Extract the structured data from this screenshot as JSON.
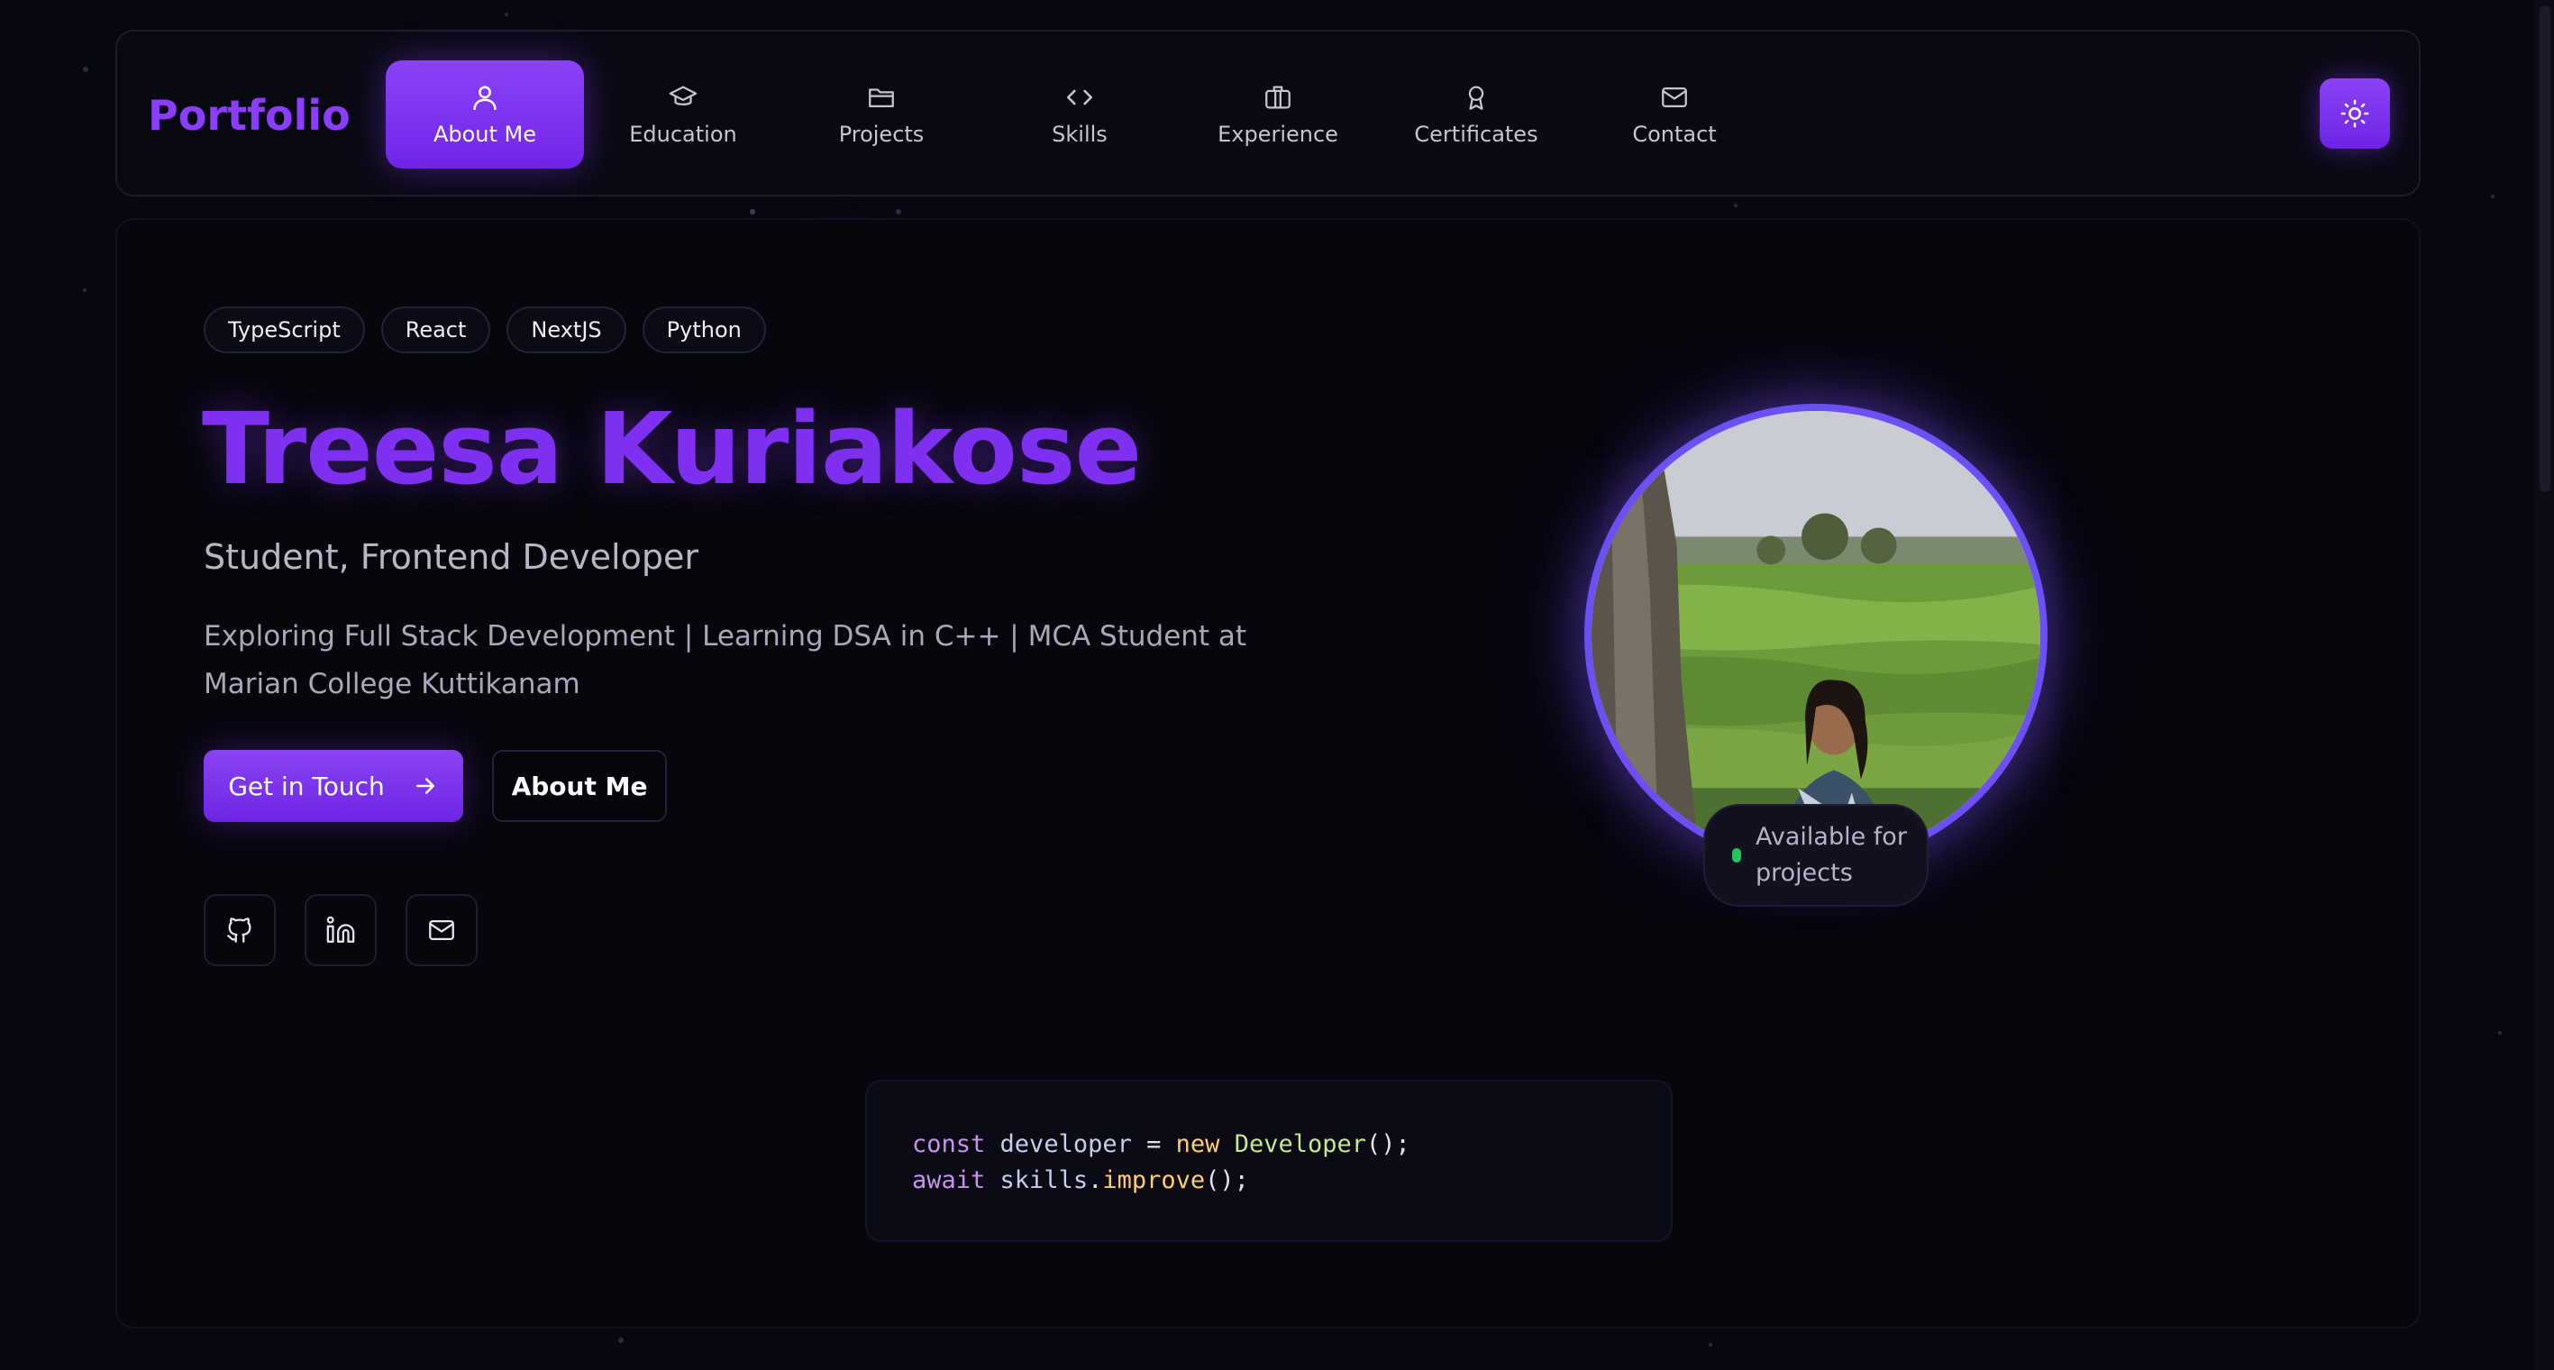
{
  "brand": {
    "logo": "Portfolio"
  },
  "nav": {
    "items": [
      {
        "label": "About Me",
        "icon": "user-icon",
        "active": true
      },
      {
        "label": "Education",
        "icon": "graduation-cap-icon"
      },
      {
        "label": "Projects",
        "icon": "folder-icon"
      },
      {
        "label": "Skills",
        "icon": "code-icon"
      },
      {
        "label": "Experience",
        "icon": "briefcase-icon"
      },
      {
        "label": "Certificates",
        "icon": "award-icon"
      },
      {
        "label": "Contact",
        "icon": "mail-icon"
      }
    ],
    "theme_toggle_icon": "sun-icon"
  },
  "hero": {
    "tags": [
      "TypeScript",
      "React",
      "NextJS",
      "Python"
    ],
    "name": "Treesa Kuriakose",
    "role": "Student, Frontend Developer",
    "description": "Exploring Full Stack Development | Learning DSA in C++ | MCA Student at Marian College Kuttikanam",
    "primary_button": "Get in Touch",
    "secondary_button": "About Me",
    "social_icons": [
      "github-icon",
      "linkedin-icon",
      "mail-icon"
    ],
    "availability": "Available for projects"
  },
  "code_snippet": {
    "line1": {
      "kw": "const",
      "var": "developer",
      "op": " = ",
      "new": "new",
      "cls": "Developer",
      "end": "();"
    },
    "line2": {
      "kw": "await",
      "obj": "skills",
      "dot": ".",
      "fn": "improve",
      "end": "();"
    }
  },
  "colors": {
    "accent": "#7c3aed",
    "background": "#07070f",
    "avatar_ring": "#6d50f5",
    "status_dot": "#22c55e"
  }
}
